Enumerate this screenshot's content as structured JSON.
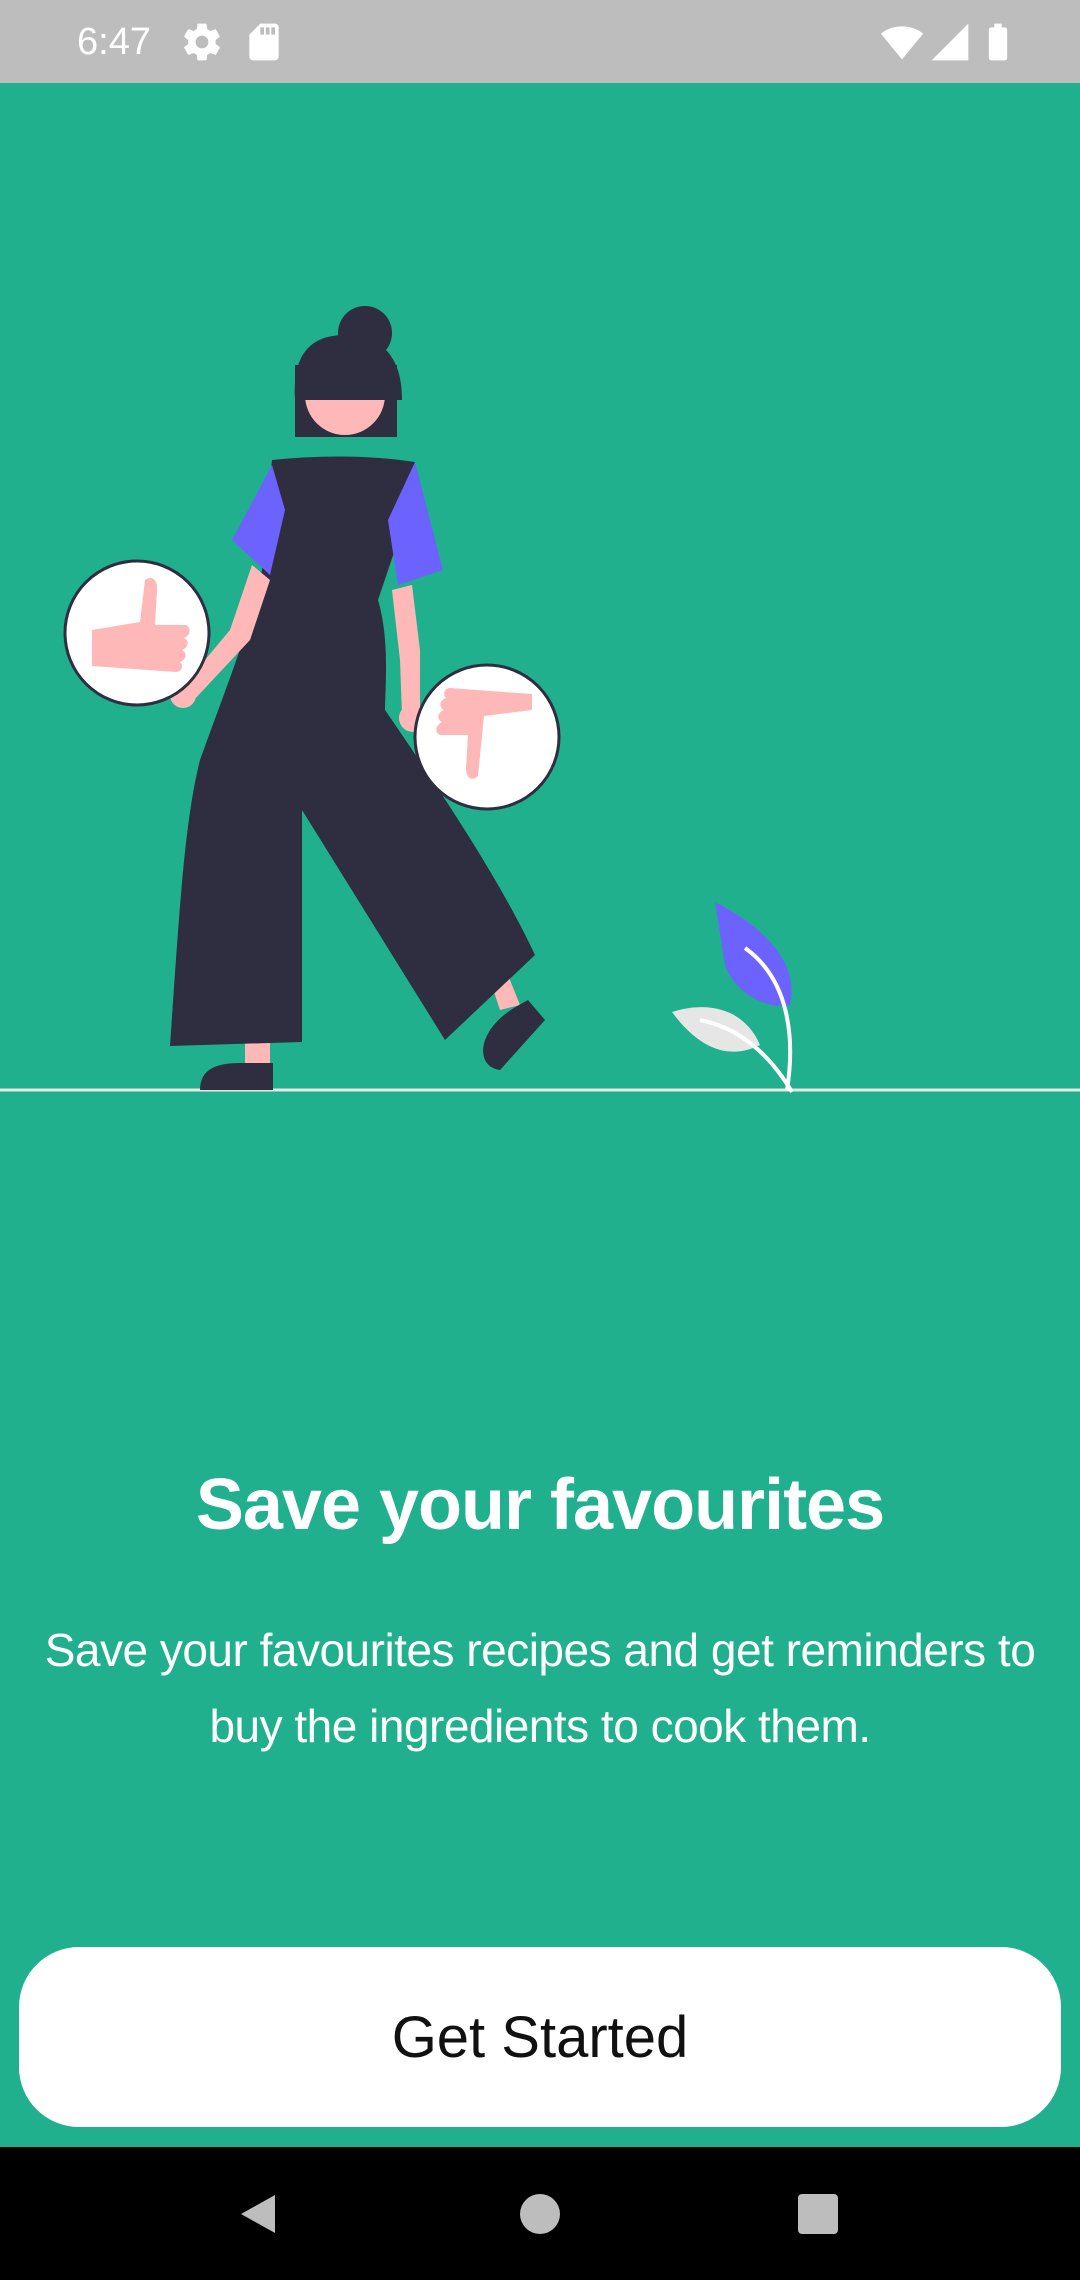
{
  "status_bar": {
    "time": "6:47",
    "icons": [
      "gear-icon",
      "sd-card-icon",
      "wifi-icon",
      "cell-signal-icon",
      "battery-icon"
    ]
  },
  "onboarding": {
    "title": "Save your favourites",
    "description": "Save your favourites recipes and get reminders to buy the ingredients to cook them.",
    "cta_label": "Get Started"
  },
  "nav_bar": {
    "buttons": [
      "back-icon",
      "home-icon",
      "recents-icon"
    ]
  },
  "colors": {
    "background": "#20B08E",
    "status_bar": "#BDBDBD",
    "accent_purple": "#6C63FF",
    "figure_dark": "#2F2E41",
    "skin": "#FFB8B8",
    "button_bg": "#FFFFFF"
  }
}
